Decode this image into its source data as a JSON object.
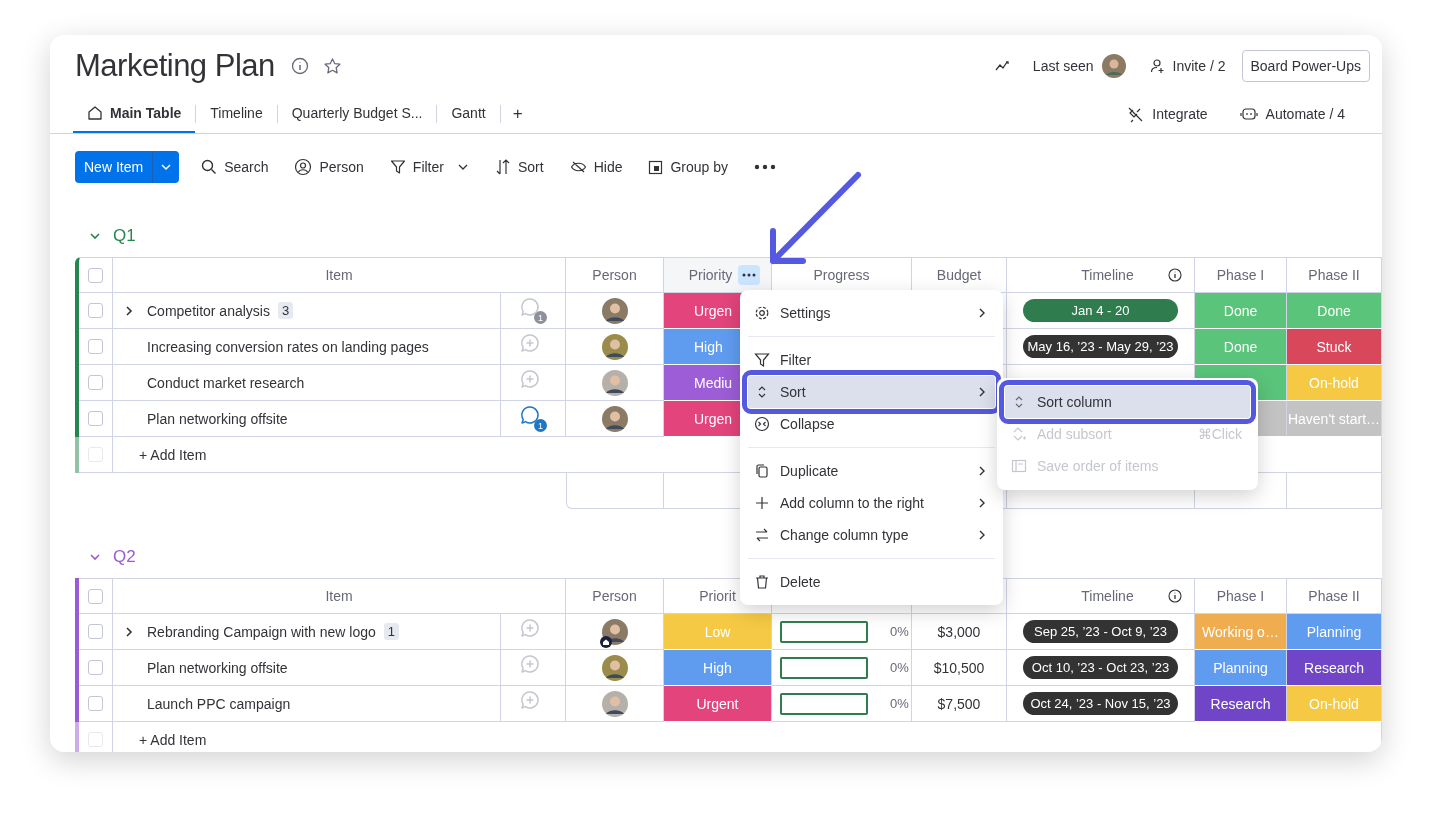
{
  "board": {
    "title": "Marketing Plan"
  },
  "header_actions": {
    "last_seen": "Last seen",
    "invite": "Invite / 2",
    "power_ups": "Board Power-Ups"
  },
  "views": [
    {
      "kind": "home",
      "label": "Main Table",
      "selected": true
    },
    {
      "kind": "view",
      "label": "Timeline",
      "selected": false
    },
    {
      "kind": "view",
      "label": "Quarterly Budget S...",
      "selected": false
    },
    {
      "kind": "view",
      "label": "Gantt",
      "selected": false
    }
  ],
  "add_view": "+",
  "view_actions": [
    {
      "kind": "integrate",
      "label": "Integrate"
    },
    {
      "kind": "automate",
      "label": "Automate / 4"
    }
  ],
  "toolbar": {
    "new_item": "New Item",
    "tools": [
      {
        "kind": "search",
        "label": "Search"
      },
      {
        "kind": "person",
        "label": "Person"
      },
      {
        "kind": "filter",
        "label": "Filter"
      },
      {
        "kind": "sort",
        "label": "Sort"
      },
      {
        "kind": "hide",
        "label": "Hide"
      },
      {
        "kind": "group",
        "label": "Group by"
      }
    ]
  },
  "groups": [
    {
      "title": "Q1",
      "color": "#258750",
      "summary_row": true,
      "all_checked": false,
      "columns": [
        {
          "label": "Item"
        },
        {
          "label": "Person"
        },
        {
          "label": "Priority",
          "menu_open": true
        },
        {
          "label": "Progress"
        },
        {
          "label": "Budget"
        },
        {
          "label": "Timeline",
          "info": true
        },
        {
          "label": "Phase I"
        },
        {
          "label": "Phase II"
        }
      ],
      "rows": [
        {
          "checked": false,
          "name": "Competitor analysis",
          "subitems": "3",
          "updates": {
            "kind": "read",
            "count": "1"
          },
          "person": {
            "guest": false
          },
          "priority": {
            "label": "Urgen",
            "color": "#e2447b"
          },
          "timeline": {
            "label": "Jan 4 - 20",
            "color": "#2f7d4f"
          },
          "phase_1": {
            "label": "Done",
            "color": "#5ac47a"
          },
          "phase_2": {
            "label": "Done",
            "color": "#5ac47a"
          }
        },
        {
          "checked": false,
          "name": "Increasing conversion rates on landing pages",
          "updates": {
            "kind": "none"
          },
          "person": {
            "guest": false
          },
          "priority": {
            "label": "High",
            "color": "#5f9cf0"
          },
          "timeline": {
            "label": "May 16, ’23 - May 29, ’23",
            "color": "#333333"
          },
          "phase_1": {
            "label": "Done",
            "color": "#5ac47a"
          },
          "phase_2": {
            "label": "Stuck",
            "color": "#d9475a"
          }
        },
        {
          "checked": false,
          "name": "Conduct market research",
          "updates": {
            "kind": "none"
          },
          "person": {
            "guest": false
          },
          "priority": {
            "label": "Mediu",
            "color": "#9d5dd6"
          },
          "phase_1": {
            "color": "#5ac47a"
          },
          "phase_2": {
            "label": "On-hold",
            "color": "#f5c944"
          }
        },
        {
          "checked": false,
          "name": "Plan networking offsite",
          "updates": {
            "kind": "unread",
            "count": "1"
          },
          "person": {
            "guest": false
          },
          "priority": {
            "label": "Urgen",
            "color": "#e2447b"
          },
          "phase_1": {
            "color": "#c3c3c3"
          },
          "phase_2": {
            "label": "Haven't start…",
            "color": "#c3c3c3"
          }
        }
      ],
      "add_item": "+ Add Item",
      "add_checkbox_disabled": true
    },
    {
      "title": "Q2",
      "color": "#9b5ad6",
      "all_checked": false,
      "columns": [
        {
          "label": "Item"
        },
        {
          "label": "Person"
        },
        {
          "label": "Priorit"
        },
        {},
        {},
        {
          "label": "Timeline",
          "info": true
        },
        {
          "label": "Phase I"
        },
        {
          "label": "Phase II"
        }
      ],
      "rows": [
        {
          "checked": false,
          "name": "Rebranding Campaign with new logo",
          "subitems": "1",
          "updates": {
            "kind": "none"
          },
          "person": {
            "guest": true
          },
          "priority": {
            "label": "Low",
            "color": "#f5c944"
          },
          "progress": {
            "level": 0,
            "reading": "0%"
          },
          "budget": "$3,000",
          "timeline": {
            "label": "Sep 25, ’23 - Oct 9, ’23",
            "color": "#333333"
          },
          "phase_1": {
            "label": "Working o…",
            "color": "#f0ad50"
          },
          "phase_2": {
            "label": "Planning",
            "color": "#5f9cf0"
          }
        },
        {
          "checked": false,
          "name": "Plan networking offsite",
          "updates": {
            "kind": "none"
          },
          "person": {
            "guest": false
          },
          "priority": {
            "label": "High",
            "color": "#5f9cf0"
          },
          "progress": {
            "level": 0,
            "reading": "0%"
          },
          "budget": "$10,500",
          "timeline": {
            "label": "Oct 10, ’23 - Oct 23, ’23",
            "color": "#333333"
          },
          "phase_1": {
            "label": "Planning",
            "color": "#5f9cf0"
          },
          "phase_2": {
            "label": "Research",
            "color": "#7045c8"
          }
        },
        {
          "checked": false,
          "name": "Launch PPC campaign",
          "updates": {
            "kind": "none"
          },
          "person": {
            "guest": false
          },
          "priority": {
            "label": "Urgent",
            "color": "#e2447b"
          },
          "progress": {
            "level": 0,
            "reading": "0%"
          },
          "budget": "$7,500",
          "timeline": {
            "label": "Oct 24, ’23 - Nov 15, ’23",
            "color": "#333333"
          },
          "phase_1": {
            "label": "Research",
            "color": "#7045c8"
          },
          "phase_2": {
            "label": "On-hold",
            "color": "#f5c944"
          }
        }
      ],
      "add_item": "+ Add Item",
      "add_checkbox_disabled": true
    }
  ],
  "column_menu": {
    "sections": [
      [
        {
          "kind": "settings",
          "label": "Settings",
          "submenu": true,
          "selected": false
        }
      ],
      [
        {
          "kind": "filter",
          "label": "Filter",
          "submenu": false,
          "selected": false
        },
        {
          "kind": "sort",
          "label": "Sort",
          "submenu": true,
          "selected": true
        },
        {
          "kind": "collapse",
          "label": "Collapse",
          "submenu": false,
          "selected": false
        }
      ],
      [
        {
          "kind": "duplicate",
          "label": "Duplicate",
          "submenu": true,
          "selected": false
        },
        {
          "kind": "add",
          "label": "Add column to the right",
          "submenu": true,
          "selected": false
        },
        {
          "kind": "change",
          "label": "Change column type",
          "submenu": true,
          "selected": false
        }
      ],
      [
        {
          "kind": "delete",
          "label": "Delete",
          "submenu": false,
          "selected": false
        }
      ]
    ]
  },
  "sort_menu": {
    "items": [
      {
        "kind": "sort",
        "label": "Sort column",
        "selected": true,
        "disabled": false
      },
      {
        "kind": "subsort",
        "label": "Add subsort",
        "shortcut": "⌘Click",
        "selected": false,
        "disabled": true
      },
      {
        "kind": "save",
        "label": "Save order of items",
        "selected": false,
        "disabled": true
      }
    ]
  }
}
